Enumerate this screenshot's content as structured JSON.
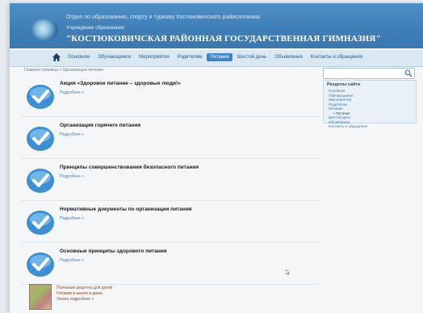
{
  "header": {
    "org_name": "Отдел по образованию, спорту и туризму Костюковичского райисполкома",
    "inst_type": "Учреждение образования",
    "site_title": "\"КОСТЮКОВИЧСКАЯ РАЙОННАЯ ГОСУДАРСТВЕННАЯ ГИМНАЗИЯ\""
  },
  "nav": {
    "items": [
      {
        "label": "Основное"
      },
      {
        "label": "Обучающимся"
      },
      {
        "label": "Мероприятия"
      },
      {
        "label": "Родителям"
      },
      {
        "label": "Питание"
      },
      {
        "label": "Шестой день"
      },
      {
        "label": "Объявления"
      },
      {
        "label": "Контакты и обращения"
      }
    ],
    "active": "Питание"
  },
  "breadcrumb": "Главная страница » Организация питания",
  "articles": [
    {
      "title": "Акция «Здоровое питание – здоровые люди!»",
      "more": "Подробнее »"
    },
    {
      "title": "Организация горячего питания",
      "more": "Подробнее »"
    },
    {
      "title": "Принципы совершенствования безопасного питания",
      "more": "Подробнее »"
    },
    {
      "title": "Нормативные документы по организации питания",
      "more": "Подробнее »"
    },
    {
      "title": "Основные принципы здорового питания",
      "more": "Подробнее »"
    }
  ],
  "book": {
    "line1": "Полезные рецепты для детей",
    "line2": "Готовим в школе и дома",
    "line3": "Узнать подробнее »"
  },
  "sidebar": {
    "search_placeholder": "",
    "title": "Разделы сайта",
    "items": [
      {
        "label": "Основное",
        "sub": false
      },
      {
        "label": "Обучающимся",
        "sub": false
      },
      {
        "label": "Мероприятия",
        "sub": false
      },
      {
        "label": "Родителям",
        "sub": false
      },
      {
        "label": "Питание",
        "sub": false
      },
      {
        "label": "• Питание",
        "sub": true
      },
      {
        "label": "Шестой день",
        "sub": false
      },
      {
        "label": "Объявления",
        "sub": false
      },
      {
        "label": "Контакты и обращения",
        "sub": false
      }
    ]
  },
  "colors": {
    "header": "#3f7fb8",
    "nav_active": "#3f85c4",
    "link": "#4c7fb0"
  }
}
